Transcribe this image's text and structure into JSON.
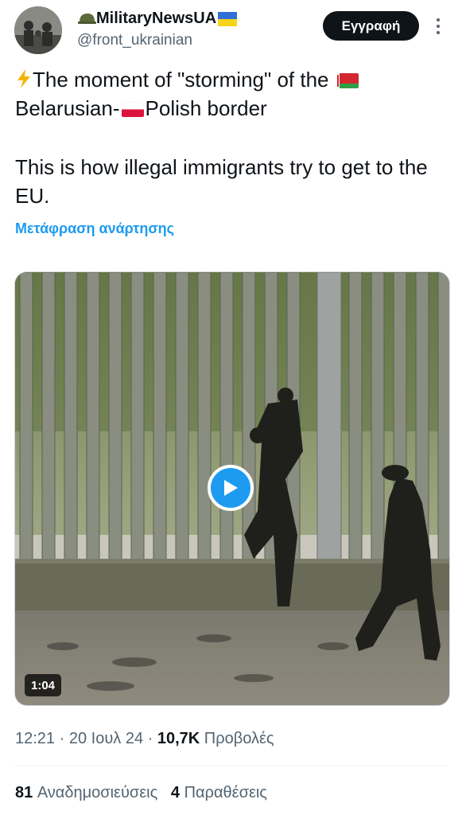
{
  "header": {
    "display_name": "MilitaryNewsUA",
    "handle": "@front_ukrainian",
    "follow_label": "Εγγραφή"
  },
  "tweet": {
    "line1_a": "The moment of \"storming\" of the",
    "line1_b": "Belarusian-",
    "line1_c": "Polish border",
    "line2": "This is how illegal immigrants try to get to the EU.",
    "translate_label": "Μετάφραση ανάρτησης"
  },
  "media": {
    "duration": "1:04"
  },
  "meta": {
    "time": "12:21",
    "sep": " · ",
    "date": "20 Ιουλ 24",
    "views_count": "10,7K",
    "views_label": "Προβολές"
  },
  "stats": {
    "reposts_count": "81",
    "reposts_label": "Αναδημοσιεύσεις",
    "quotes_count": "4",
    "quotes_label": "Παραθέσεις"
  },
  "icons": [
    "helmet-icon",
    "ukraine-flag-icon",
    "lightning-icon",
    "belarus-flag-icon",
    "poland-flag-icon",
    "play-icon",
    "more-options-icon"
  ],
  "colors": {
    "accent": "#1d9bf0",
    "text": "#0f1419",
    "secondary": "#536471"
  }
}
